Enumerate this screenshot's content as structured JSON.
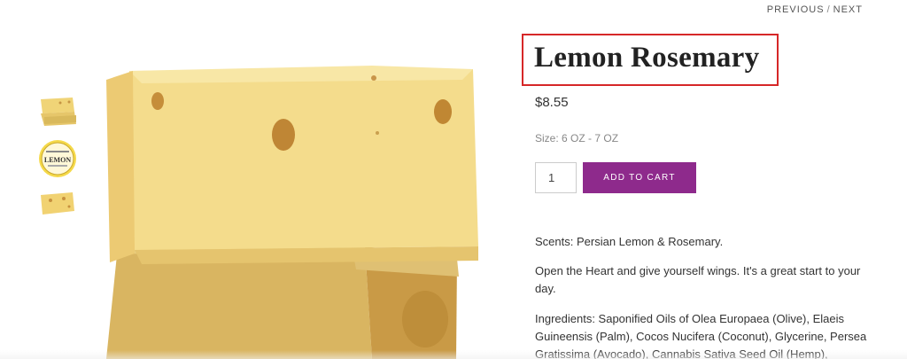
{
  "nav": {
    "previous_label": "PREVIOUS",
    "separator": "/",
    "next_label": "NEXT"
  },
  "product": {
    "title": "Lemon Rosemary",
    "price": "$8.55",
    "size": "Size: 6 OZ - 7 OZ",
    "quantity": "1",
    "add_to_cart_label": "ADD TO CART",
    "description": [
      "Scents: Persian Lemon & Rosemary.",
      "Open the Heart and give yourself wings. It's a great start to your day.",
      "Ingredients: Saponified Oils of Olea Europaea (Olive), Elaeis Guineensis (Palm), Cocos Nucifera (Coconut), Glycerine, Persea Gratissima (Avocado), Cannabis Sativa Seed Oil (Hemp),"
    ]
  },
  "thumbnails": [
    {
      "name": "soap-bars-thumbnail"
    },
    {
      "name": "lemon-label-thumbnail",
      "label": "LEMON"
    },
    {
      "name": "soap-bar-side-thumbnail"
    }
  ],
  "colors": {
    "accent": "#8e2a8c",
    "highlight_box": "#d62728",
    "soap": "#f2d98a"
  }
}
